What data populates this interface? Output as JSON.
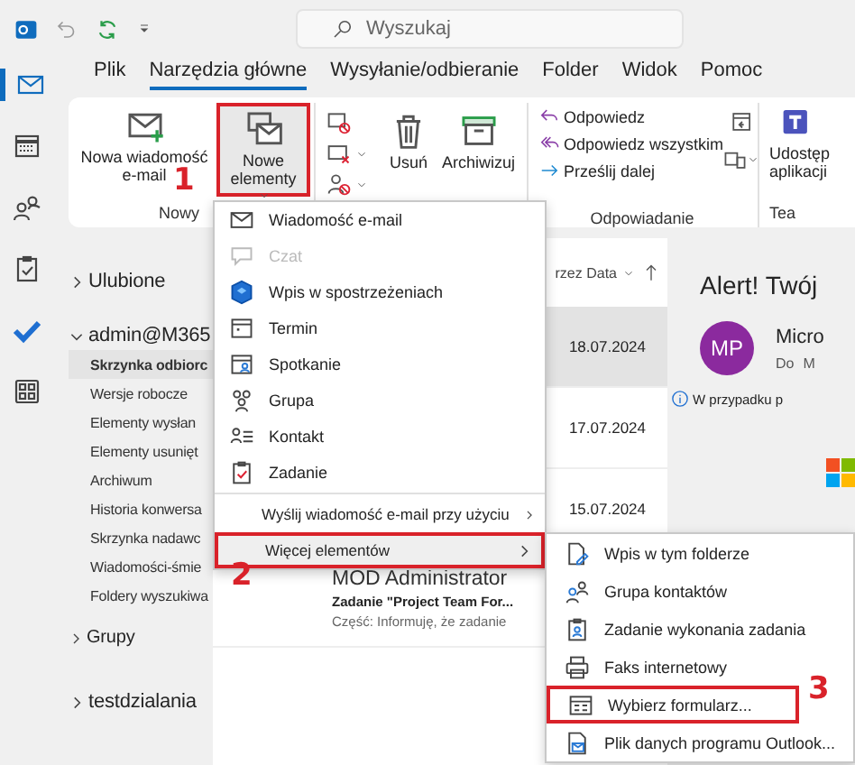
{
  "title_bar": {
    "search": {
      "placeholder": "Wyszukaj"
    }
  },
  "nav_rail": [
    {
      "kind": "mail",
      "selected": true
    },
    {
      "kind": "calendar",
      "selected": false
    },
    {
      "kind": "people",
      "selected": false
    },
    {
      "kind": "tasks",
      "selected": false
    },
    {
      "kind": "todo",
      "selected": false
    },
    {
      "kind": "apps",
      "selected": false
    }
  ],
  "tabs": [
    {
      "label": "Plik",
      "selected": false
    },
    {
      "label": "Narzędzia główne",
      "selected": true
    },
    {
      "label": "Wysyłanie/odbieranie",
      "selected": false
    },
    {
      "label": "Folder",
      "selected": false
    },
    {
      "label": "Widok",
      "selected": false
    },
    {
      "label": "Pomoc",
      "selected": false
    }
  ],
  "ribbon": {
    "new_group": {
      "label": "Nowy",
      "new_email": "Nowa wiadomość e-mail",
      "new_items": "Nowe elementy",
      "annotation": "1"
    },
    "delete_group": {
      "delete": "Usuń",
      "archive": "Archiwizuj"
    },
    "respond_group": {
      "label": "Odpowiadanie",
      "reply": "Odpowiedz",
      "reply_all": "Odpowiedz wszystkim",
      "forward": "Prześlij dalej"
    },
    "teams_group": {
      "button_lines": [
        "Udostęp",
        "aplikacji"
      ],
      "label": "Tea"
    }
  },
  "folder_pane": {
    "favorites": "Ulubione",
    "account": "admin@M365",
    "folders": [
      {
        "name": "Skrzynka odbiorc",
        "selected": true
      },
      {
        "name": "Wersje robocze",
        "selected": false
      },
      {
        "name": "Elementy wysłan",
        "selected": false
      },
      {
        "name": "Elementy usunięt",
        "selected": false
      },
      {
        "name": "Archiwum",
        "selected": false
      },
      {
        "name": "Historia konwersa",
        "selected": false
      },
      {
        "name": "Skrzynka nadawc",
        "selected": false
      },
      {
        "name": "Wiadomości-śmie",
        "selected": false
      },
      {
        "name": "Foldery wyszukiwa",
        "selected": false
      }
    ],
    "groups": "Grupy",
    "other_account": "testdzialania"
  },
  "message_list": {
    "sort": "rzez Data",
    "rows": [
      {
        "date": "18.07.2024",
        "selected": true
      },
      {
        "date": "17.07.2024",
        "selected": false
      },
      {
        "date": "15.07.2024",
        "selected": false
      },
      {
        "sender": "MOD Administrator",
        "subject": "Zadanie \"Project Team For...",
        "snippet": "Część:  Informuję, że zadanie",
        "selected": false
      }
    ]
  },
  "reading_pane": {
    "subject": "Alert! Twój",
    "avatar": "MP",
    "sender": "Micro",
    "to_label": "Do",
    "to": "M",
    "info": "W przypadku p"
  },
  "new_items_menu": {
    "items": [
      {
        "label": "Wiadomość e-mail",
        "kind": "mail",
        "disabled": false
      },
      {
        "label": "Czat",
        "kind": "chat",
        "disabled": true
      },
      {
        "label": "Wpis w spostrzeżeniach",
        "kind": "insight",
        "disabled": false
      },
      {
        "label": "Termin",
        "kind": "calendar",
        "disabled": false
      },
      {
        "label": "Spotkanie",
        "kind": "meeting",
        "disabled": false
      },
      {
        "label": "Grupa",
        "kind": "group",
        "disabled": false
      },
      {
        "label": "Kontakt",
        "kind": "contact",
        "disabled": false
      },
      {
        "label": "Zadanie",
        "kind": "task",
        "disabled": false
      }
    ],
    "submenus": [
      {
        "label": "Wyślij wiadomość e-mail przy użyciu",
        "selected": false
      },
      {
        "label": "Więcej elementów",
        "selected": true,
        "annotation": "2"
      }
    ]
  },
  "more_items_menu": {
    "items": [
      {
        "label": "Wpis w tym folderze",
        "kind": "post"
      },
      {
        "label": "Grupa kontaktów",
        "kind": "contactgroup"
      },
      {
        "label": "Zadanie wykonania zadania",
        "kind": "taskrequest"
      },
      {
        "label": "Faks internetowy",
        "kind": "fax"
      },
      {
        "label": "Wybierz formularz...",
        "kind": "form",
        "annotation": "3"
      },
      {
        "label": "Plik danych programu Outlook...",
        "kind": "datafile"
      }
    ]
  }
}
